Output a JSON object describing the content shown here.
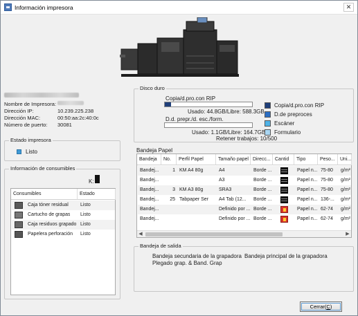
{
  "window": {
    "title": "Información impresora",
    "close_glyph": "✕"
  },
  "printer_info": {
    "name_label": "Nombre de Impresora:",
    "ip_label": "Dirección IP:",
    "ip_value": "10.239.225.238",
    "mac_label": "Dirección MAC:",
    "mac_value": "00:50:aa:2c:40:0c",
    "port_label": "Número de puerto:",
    "port_value": "30081"
  },
  "printer_status": {
    "title": "Estado impresora",
    "value": "Listo",
    "color": "#3f9ad6"
  },
  "consumables": {
    "title": "Información de consumibles",
    "k_label": "K:",
    "headers": [
      "Consumibles",
      "Estado"
    ],
    "rows": [
      {
        "name": "Caja tóner residual",
        "status": "Listo",
        "icon": "toner-box-icon"
      },
      {
        "name": "Cartucho de grapas",
        "status": "Listo",
        "icon": "staple-cartridge-icon"
      },
      {
        "name": "Caja residuos grapado",
        "status": "Listo",
        "icon": "staple-waste-icon"
      },
      {
        "name": "Papelera perforación",
        "status": "Listo",
        "icon": "punch-waste-icon"
      }
    ]
  },
  "disk": {
    "title": "Disco duro",
    "copy": {
      "label": "Copia/d.pro.con RIP",
      "usage": "Usado: 44.8GB/Libre: 588.3GB",
      "fill_fraction": 0.07
    },
    "preproc": {
      "label": "D.d. prepr./d. esc./form.",
      "usage": "Usado: 1.1GB/Libre: 164.7GB",
      "retain": "Retener trabajos: 10/500",
      "fill_fraction": 0.0
    },
    "legend": [
      {
        "label": "Copia/d.pro.con RIP",
        "color": "#1f3f7a"
      },
      {
        "label": "D.de preproces",
        "color": "#2c6fc4"
      },
      {
        "label": "Escáner",
        "color": "#4fb3e8"
      },
      {
        "label": "Formulario",
        "color": "#a9d6f2"
      }
    ]
  },
  "trays": {
    "title": "Bandeja Papel",
    "headers": [
      "Bandeja",
      "No.",
      "Perfil Papel",
      "Tamaño papel",
      "Direcc...",
      "Cantid",
      "Tipo",
      "Peso...",
      "Uni..."
    ],
    "rows": [
      {
        "bandeja": "Bandej...",
        "no": "1",
        "perfil": "KM A4 80g",
        "tamano": "A4",
        "direccion": "Borde ...",
        "cantidad": "full",
        "tipo": "Papel n...",
        "peso": "75-80",
        "uni": "g/m²"
      },
      {
        "bandeja": "Bandej...",
        "no": "",
        "perfil": "",
        "tamano": "A3",
        "direccion": "Borde ...",
        "cantidad": "full",
        "tipo": "Papel n...",
        "peso": "75-80",
        "uni": "g/m²"
      },
      {
        "bandeja": "Bandej...",
        "no": "3",
        "perfil": "KM A3 80g",
        "tamano": "SRA3",
        "direccion": "Borde ...",
        "cantidad": "full",
        "tipo": "Papel n...",
        "peso": "75-80",
        "uni": "g/m²"
      },
      {
        "bandeja": "Bandej...",
        "no": "25",
        "perfil": "Tabpaper Ser",
        "tamano": "A4 Tab (12...",
        "direccion": "Borde ...",
        "cantidad": "full",
        "tipo": "Papel n...",
        "peso": "136-...",
        "uni": "g/m²"
      },
      {
        "bandeja": "Bandej...",
        "no": "",
        "perfil": "",
        "tamano": "Definido por ...",
        "direccion": "Borde ...",
        "cantidad": "empty",
        "tipo": "Papel n...",
        "peso": "62-74",
        "uni": "g/m²"
      },
      {
        "bandeja": "Bandej...",
        "no": "",
        "perfil": "",
        "tamano": "Definido por ...",
        "direccion": "Borde ...",
        "cantidad": "empty",
        "tipo": "Papel n...",
        "peso": "62-74",
        "uni": "g/m²"
      }
    ]
  },
  "output_trays": {
    "title": "Bandeja de salida",
    "items": [
      "Bandeja secundaria de la grapadora",
      "Bandeja principal de la grapadora",
      "Plegado grap. & Band. Grap"
    ]
  },
  "footer": {
    "close_label": "Cerrar(",
    "close_key": "C",
    "close_suffix": ")"
  }
}
